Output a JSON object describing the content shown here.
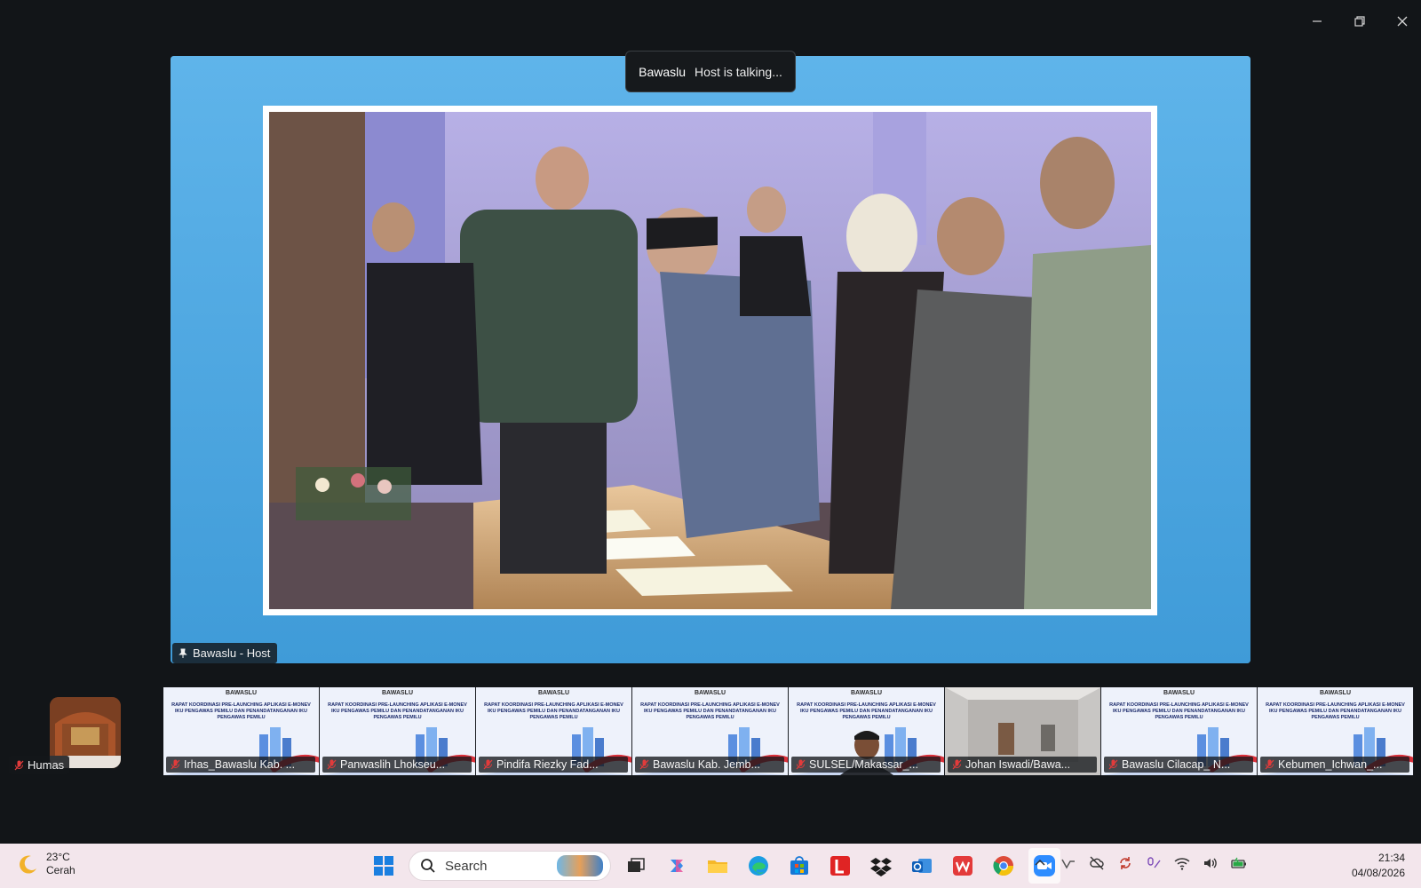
{
  "window": {
    "controls": [
      "minimize-icon",
      "restore-icon",
      "close-icon"
    ]
  },
  "meeting": {
    "talking_name": "Bawaslu",
    "talking_status": "Host is talking...",
    "main_video_label": "Bawaslu - Host",
    "self_label": "Humas"
  },
  "slide": {
    "logo_text": "BAWASLU",
    "title": "RAPAT KOORDINASI PRE-LAUNCHING APLIKASI E-MONEV IKU PENGAWAS PEMILU DAN PENANDATANGANAN IKU PENGAWAS PEMILU"
  },
  "participants": [
    {
      "name": "Irhas_Bawaslu Kab. ...",
      "kind": "slide"
    },
    {
      "name": "Panwaslih Lhokseu...",
      "kind": "slide"
    },
    {
      "name": "Pindifa Riezky Fad...",
      "kind": "slide"
    },
    {
      "name": "Bawaslu Kab. Jemb...",
      "kind": "slide"
    },
    {
      "name": "SULSEL/Makassar_...",
      "kind": "slide-person"
    },
    {
      "name": "Johan Iswadi/Bawa...",
      "kind": "room"
    },
    {
      "name": "Bawaslu Cilacap_ N...",
      "kind": "slide"
    },
    {
      "name": "Kebumen_Ichwan_...",
      "kind": "slide"
    }
  ],
  "taskbar": {
    "weather_temp": "23°C",
    "weather_desc": "Cerah",
    "search_placeholder": "Search",
    "apps": [
      "windows-start-icon",
      "search-box",
      "task-view-icon",
      "copilot-icon",
      "file-explorer-icon",
      "edge-icon",
      "store-icon",
      "l-app-icon",
      "dropbox-icon",
      "outlook-icon",
      "wps-icon",
      "chrome-icon",
      "zoom-icon"
    ],
    "time": "21:34",
    "date": "04/08/2026"
  },
  "colors": {
    "stage_blue": "#4aa6e0",
    "taskbar_bg": "#f3e6ec",
    "app_bg": "#121518"
  }
}
